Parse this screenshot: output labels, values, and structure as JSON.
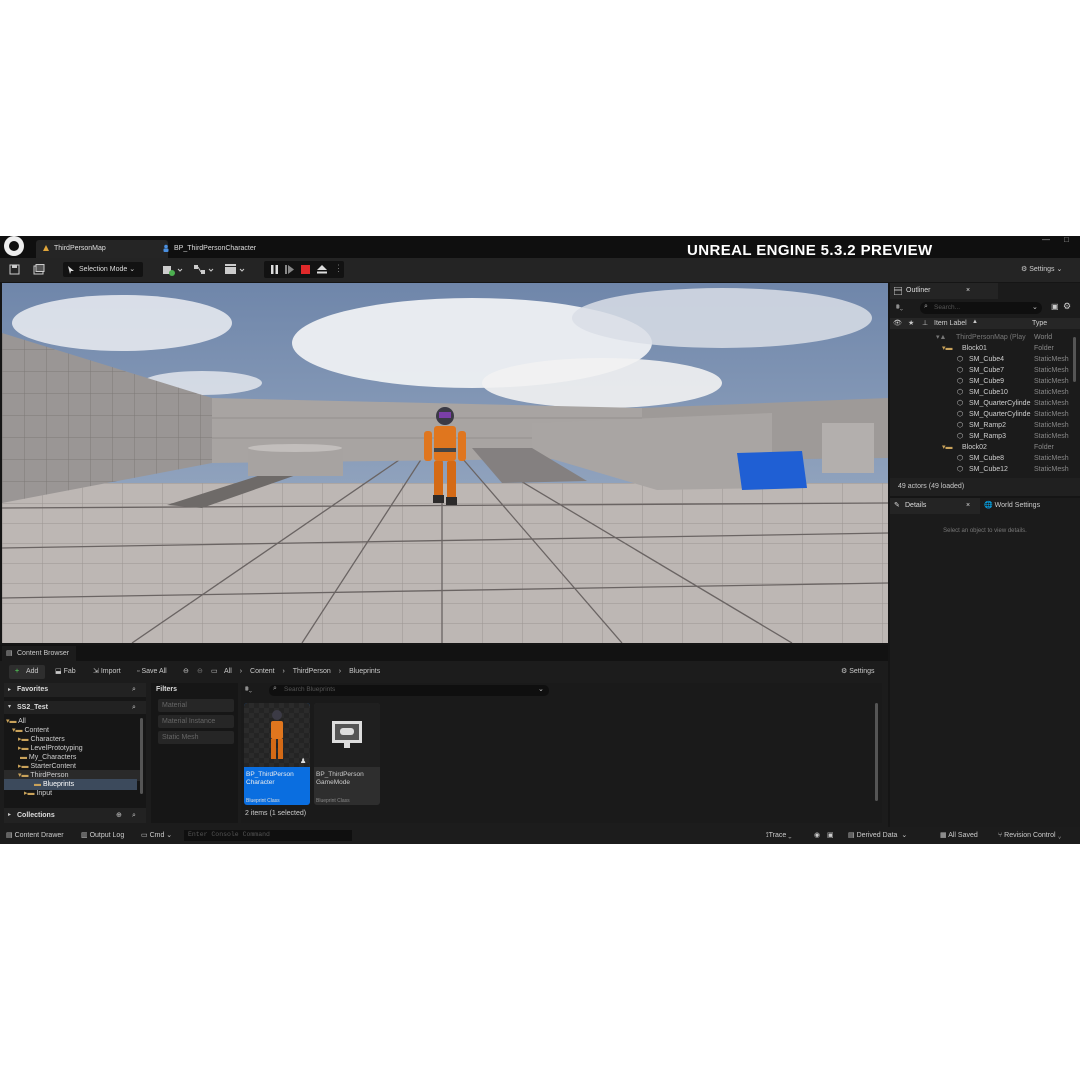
{
  "brand": "UNREAL ENGINE 5.3.2 PREVIEW",
  "tabs": [
    {
      "label": "ThirdPersonMap"
    },
    {
      "label": "BP_ThirdPersonCharacter"
    }
  ],
  "toolbar": {
    "selection_mode": "Selection Mode",
    "settings": "Settings"
  },
  "outliner": {
    "title": "Outliner",
    "search_placeholder": "Search...",
    "col_label": "Item Label",
    "col_type": "Type",
    "rows": [
      {
        "label": "ThirdPersonMap (Play",
        "type": "World"
      },
      {
        "label": "Block01",
        "type": "Folder"
      },
      {
        "label": "SM_Cube4",
        "type": "StaticMesh"
      },
      {
        "label": "SM_Cube7",
        "type": "StaticMesh"
      },
      {
        "label": "SM_Cube9",
        "type": "StaticMesh"
      },
      {
        "label": "SM_Cube10",
        "type": "StaticMesh"
      },
      {
        "label": "SM_QuarterCylinde",
        "type": "StaticMesh"
      },
      {
        "label": "SM_QuarterCylinde",
        "type": "StaticMesh"
      },
      {
        "label": "SM_Ramp2",
        "type": "StaticMesh"
      },
      {
        "label": "SM_Ramp3",
        "type": "StaticMesh"
      },
      {
        "label": "Block02",
        "type": "Folder"
      },
      {
        "label": "SM_Cube8",
        "type": "StaticMesh"
      },
      {
        "label": "SM_Cube12",
        "type": "StaticMesh"
      }
    ],
    "footer": "49 actors (49 loaded)"
  },
  "details": {
    "tab_details": "Details",
    "tab_world": "World Settings",
    "empty": "Select an object to view details."
  },
  "content_browser": {
    "title": "Content Browser",
    "add": "Add",
    "fab": "Fab",
    "import": "Import",
    "save_all": "Save All",
    "breadcrumb": [
      "All",
      "Content",
      "ThirdPerson",
      "Blueprints"
    ],
    "settings": "Settings",
    "favorites": "Favorites",
    "project": "SS2_Test",
    "tree": [
      {
        "label": "All"
      },
      {
        "label": "Content"
      },
      {
        "label": "Characters"
      },
      {
        "label": "LevelPrototyping"
      },
      {
        "label": "My_Characters"
      },
      {
        "label": "StarterContent"
      },
      {
        "label": "ThirdPerson"
      },
      {
        "label": "Blueprints"
      },
      {
        "label": "Input"
      }
    ],
    "collections": "Collections",
    "filters_title": "Filters",
    "filters": [
      "Material",
      "Material Instance",
      "Static Mesh"
    ],
    "search_placeholder": "Search Blueprints",
    "assets": [
      {
        "name": "BP_ThirdPerson Character",
        "class": "Blueprint Class"
      },
      {
        "name": "BP_ThirdPerson GameMode",
        "class": "Blueprint Class"
      }
    ],
    "status": "2 items (1 selected)"
  },
  "statusbar": {
    "content_drawer": "Content Drawer",
    "output_log": "Output Log",
    "cmd": "Cmd",
    "console_placeholder": "Enter Console Command",
    "trace": "Trace",
    "derived_data": "Derived Data",
    "all_saved": "All Saved",
    "revision_control": "Revision Control"
  },
  "colors": {
    "accent": "#0070e0",
    "folder": "#c9a25a",
    "play_stop": "#e0292a"
  }
}
